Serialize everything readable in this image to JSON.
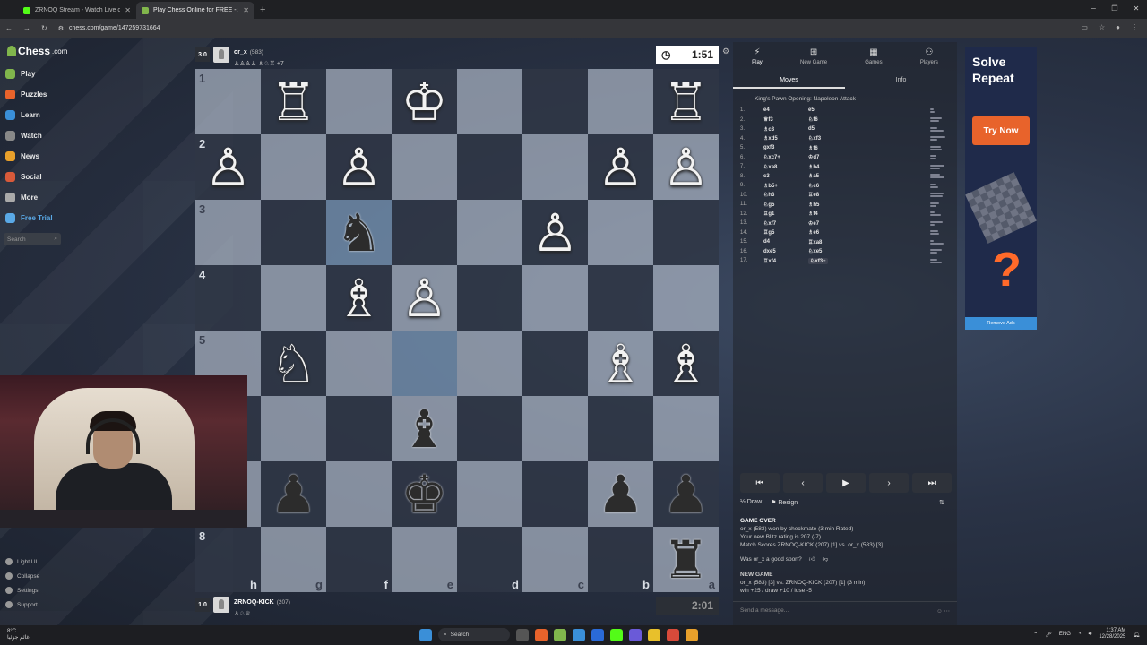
{
  "browser": {
    "tabs": [
      {
        "label": "ZRNOQ Stream - Watch Live o",
        "color": "#53fc18",
        "active": false
      },
      {
        "label": "Play Chess Online for FREE - 2",
        "color": "#81b64c",
        "active": true
      }
    ],
    "url": "chess.com/game/147259731664"
  },
  "sidebar": {
    "logo": "Chess",
    "logo_suffix": ".com",
    "items": [
      {
        "label": "Play",
        "icon": "play-icon",
        "color": "#81b64c"
      },
      {
        "label": "Puzzles",
        "icon": "puzzle-icon",
        "color": "#e8632b"
      },
      {
        "label": "Learn",
        "icon": "learn-icon",
        "color": "#3a8fd8"
      },
      {
        "label": "Watch",
        "icon": "watch-icon",
        "color": "#888"
      },
      {
        "label": "News",
        "icon": "news-icon",
        "color": "#e8a02b"
      },
      {
        "label": "Social",
        "icon": "social-icon",
        "color": "#d85a3a"
      },
      {
        "label": "More",
        "icon": "more-icon",
        "color": "#aaa"
      },
      {
        "label": "Free Trial",
        "icon": "diamond-icon",
        "color": "#5aa9e6"
      }
    ],
    "search_placeholder": "Search",
    "bottom": [
      "Light UI",
      "Collapse",
      "Settings",
      "Support"
    ]
  },
  "top_player": {
    "score": "3.0",
    "name": "or_x",
    "rating": "(583)",
    "extra": "+7",
    "clock": "1:51"
  },
  "bottom_player": {
    "score": "1.0",
    "name": "ZRNOQ-KICK",
    "rating": "(207)",
    "clock": "2:01"
  },
  "board": {
    "rank_labels": [
      "1",
      "2",
      "3",
      "4",
      "5",
      "6",
      "7",
      "8"
    ],
    "file_labels": [
      "h",
      "g",
      "f",
      "e",
      "d",
      "c",
      "b",
      "a"
    ],
    "highlight": [
      "2,2",
      "4,3"
    ],
    "pieces": [
      {
        "r": 0,
        "c": 1,
        "p": "♖"
      },
      {
        "r": 0,
        "c": 3,
        "p": "♔"
      },
      {
        "r": 0,
        "c": 7,
        "p": "♖"
      },
      {
        "r": 1,
        "c": 0,
        "p": "♙"
      },
      {
        "r": 1,
        "c": 2,
        "p": "♙"
      },
      {
        "r": 1,
        "c": 6,
        "p": "♙"
      },
      {
        "r": 1,
        "c": 7,
        "p": "♙"
      },
      {
        "r": 2,
        "c": 2,
        "p": "♞"
      },
      {
        "r": 2,
        "c": 5,
        "p": "♙"
      },
      {
        "r": 3,
        "c": 2,
        "p": "♗"
      },
      {
        "r": 3,
        "c": 3,
        "p": "♙"
      },
      {
        "r": 4,
        "c": 1,
        "p": "♘"
      },
      {
        "r": 4,
        "c": 6,
        "p": "♗"
      },
      {
        "r": 4,
        "c": 7,
        "p": "♗"
      },
      {
        "r": 5,
        "c": 3,
        "p": "♝"
      },
      {
        "r": 6,
        "c": 1,
        "p": "♟"
      },
      {
        "r": 6,
        "c": 3,
        "p": "♚"
      },
      {
        "r": 6,
        "c": 6,
        "p": "♟"
      },
      {
        "r": 6,
        "c": 7,
        "p": "♟"
      },
      {
        "r": 7,
        "c": 7,
        "p": "♜"
      }
    ]
  },
  "right_panel": {
    "tabs": [
      {
        "label": "Play",
        "icon": "bolt-icon"
      },
      {
        "label": "New Game",
        "icon": "plus-icon"
      },
      {
        "label": "Games",
        "icon": "games-icon"
      },
      {
        "label": "Players",
        "icon": "players-icon"
      }
    ],
    "subtabs": [
      "Moves",
      "Info"
    ],
    "opening": "King's Pawn Opening: Napoleon Attack",
    "moves": [
      {
        "n": "1.",
        "w": "e4",
        "b": "e5"
      },
      {
        "n": "2.",
        "w": "♕f3",
        "b": "♘f6"
      },
      {
        "n": "3.",
        "w": "♗c3",
        "b": "d5"
      },
      {
        "n": "4.",
        "w": "♗xd5",
        "b": "♘xf3"
      },
      {
        "n": "5.",
        "w": "gxf3",
        "b": "♗f6"
      },
      {
        "n": "6.",
        "w": "♘xc7+",
        "b": "♔d7"
      },
      {
        "n": "7.",
        "w": "♘xa8",
        "b": "♗b4"
      },
      {
        "n": "8.",
        "w": "c3",
        "b": "♗a5"
      },
      {
        "n": "9.",
        "w": "♗b5+",
        "b": "♘c6"
      },
      {
        "n": "10.",
        "w": "♘h3",
        "b": "♖e8"
      },
      {
        "n": "11.",
        "w": "♘g5",
        "b": "♗h5"
      },
      {
        "n": "12.",
        "w": "♖g1",
        "b": "♗f4"
      },
      {
        "n": "13.",
        "w": "♘xf7",
        "b": "♔e7"
      },
      {
        "n": "14.",
        "w": "♖g5",
        "b": "♗e6"
      },
      {
        "n": "15.",
        "w": "d4",
        "b": "♖xa8"
      },
      {
        "n": "16.",
        "w": "dxe5",
        "b": "♘xe5"
      },
      {
        "n": "17.",
        "w": "♖xf4",
        "b": "♘xf3+"
      }
    ],
    "actions": {
      "draw": "Draw",
      "resign": "Resign"
    },
    "game_over": {
      "title": "GAME OVER",
      "line1": "or_x (583) won by checkmate (3 min Rated)",
      "line2": "Your new Blitz rating is 207 (-7).",
      "line3": "Match Scores ZRNOQ-KICK (207) [1] vs. or_x (583) [3]"
    },
    "sport_question": "Was or_x a good sport?",
    "new_game": {
      "title": "NEW GAME",
      "line1": "or_x (583) [3] vs. ZRNOQ-KICK (207) [1] (3 min)",
      "line2": "win +25 / draw +10 / lose -5"
    },
    "chat_placeholder": "Send a message..."
  },
  "ad": {
    "title": "Solve Repeat",
    "button": "Try Now",
    "remove": "Remove Ads"
  },
  "taskbar": {
    "weather_temp": "8°C",
    "weather_desc": "غائم جزئيا",
    "search": "Search",
    "lang": "ENG",
    "time": "1:37 AM",
    "date": "12/28/2025"
  }
}
